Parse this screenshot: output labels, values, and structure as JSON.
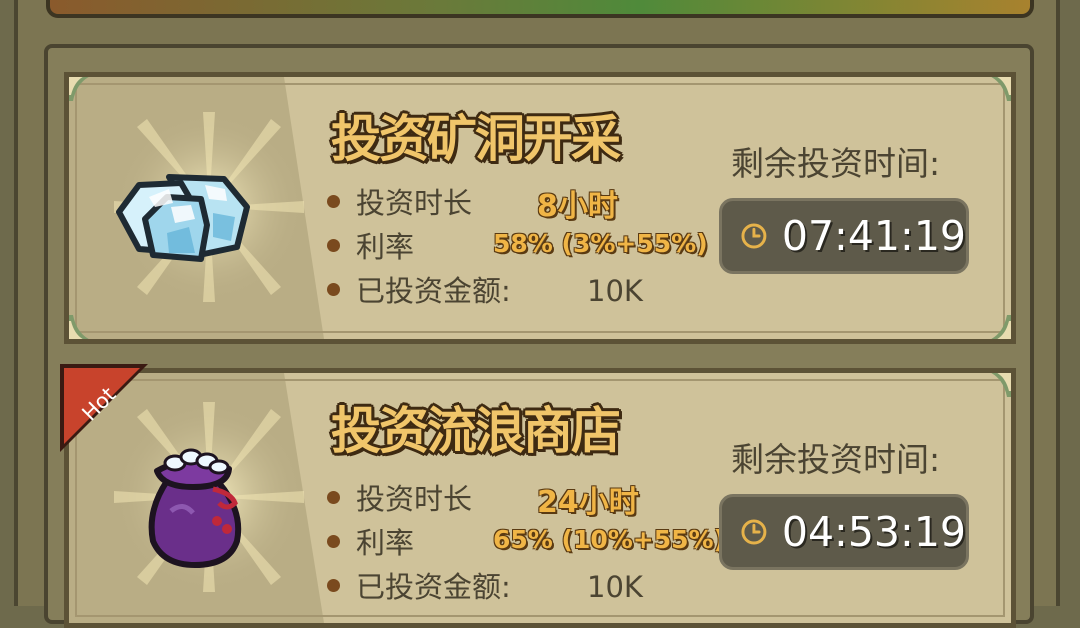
{
  "cards": [
    {
      "title": "投资矿洞开采",
      "duration_label": "投资时长",
      "duration_value": "8小时",
      "rate_label": "利率",
      "rate_value": "58% (3%+55%)",
      "amount_label": "已投资金额:",
      "amount_value": "10K",
      "remaining_label": "剩余投资时间:",
      "timer": "07:41:19",
      "icon": "diamond-ore-icon",
      "hot": false
    },
    {
      "title": "投资流浪商店",
      "duration_label": "投资时长",
      "duration_value": "24小时",
      "rate_label": "利率",
      "rate_value": "65% (10%+55%)",
      "amount_label": "已投资金额:",
      "amount_value": "10K",
      "remaining_label": "剩余投资时间:",
      "timer": "04:53:19",
      "icon": "money-bag-icon",
      "hot": true,
      "hot_label": "Hot"
    }
  ],
  "colors": {
    "title": "#f0c56a",
    "value_gold": "#f0b546",
    "card_bg": "#cfc29a",
    "timer_bg": "#5e5a4a",
    "hot_badge": "#c8432c"
  }
}
